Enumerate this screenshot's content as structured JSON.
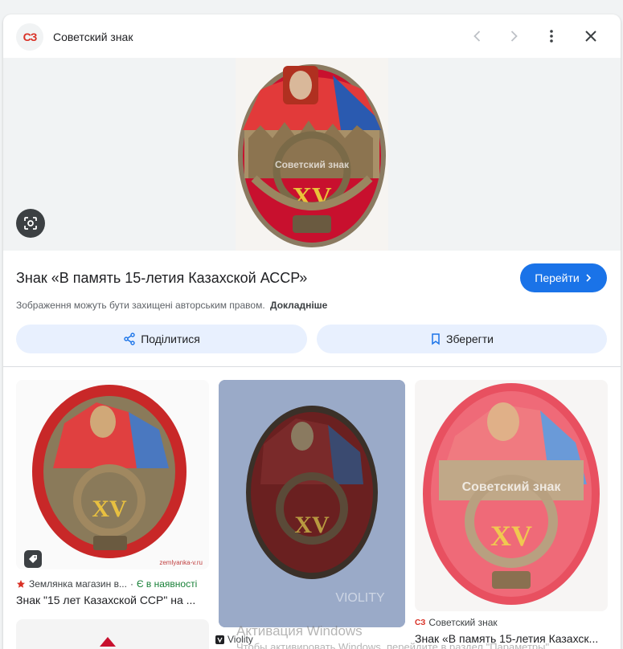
{
  "header": {
    "site_icon_text": "СЗ",
    "site_name": "Советский знак",
    "icons": [
      "chevron-left-icon",
      "chevron-right-icon",
      "more-vert-icon",
      "close-icon"
    ]
  },
  "hero": {
    "watermark": "Советский знак",
    "lens_icon": "google-lens-icon"
  },
  "result": {
    "title": "Знак «В память 15-летия Казахской АССР»",
    "visit_label": "Перейти",
    "copyright_text": "Зображення можуть бути захищені авторським правом.",
    "copyright_more": "Докладніше",
    "share_label": "Поділитися",
    "save_label": "Зберегти"
  },
  "related": [
    {
      "source": "Землянка магазин в...",
      "availability": "Є в наявності",
      "title": "Знак \"15 лет Казахской ССР\" на ...",
      "image_watermark": "zemlyanka-v.ru"
    },
    {
      "source": "Violity",
      "image_watermark": "VIOLITY"
    },
    {
      "source": "Советский знак",
      "title": "Знак «В память 15-летия Казахск...",
      "image_watermark": "Советский знак"
    }
  ],
  "os_watermark": {
    "line1": "Активация Windows",
    "line2": "Чтобы активировать Windows, перейдите в раздел \"Параметры\"."
  },
  "colors": {
    "accent": "#1a73e8",
    "action_bg": "#e8f0fe",
    "badge_red": "#c8102e",
    "badge_blue": "#2a5ab0"
  }
}
